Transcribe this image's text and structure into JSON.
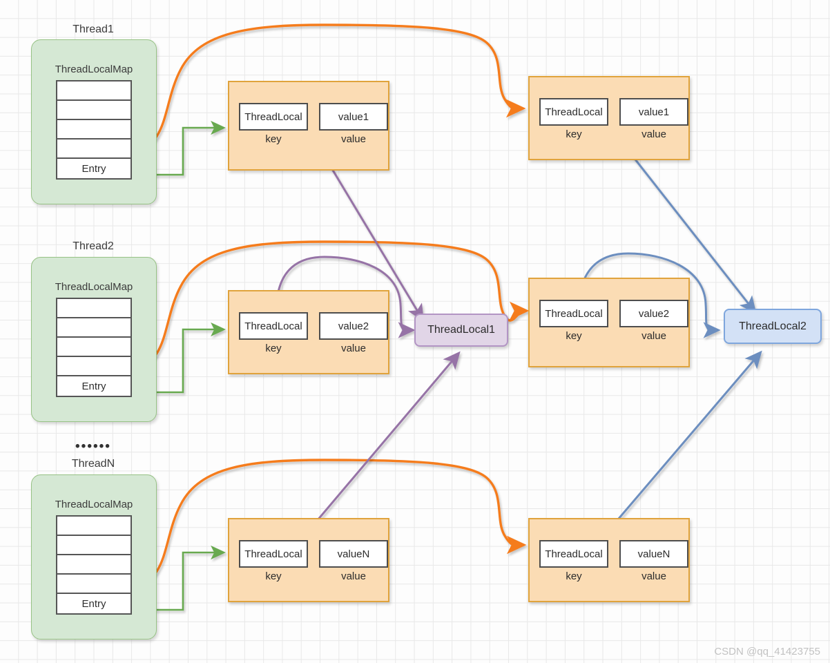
{
  "diagram": {
    "title": "ThreadLocal / ThreadLocalMap reference diagram",
    "watermark": "CSDN @qq_41423755",
    "colors": {
      "thread_fill": "#d5e8d4",
      "thread_stroke": "#82b366",
      "entry_fill": "#fbdcb4",
      "entry_stroke": "#e0a33c",
      "threadlocal1_fill": "#e1d5e7",
      "threadlocal1_stroke": "#b294c4",
      "threadlocal2_fill": "#d3e1f6",
      "threadlocal2_stroke": "#7ea6dd",
      "orange_edge": "#f57c1f",
      "green_edge": "#67a94f",
      "purple_edge": "#9673a6",
      "blue_edge": "#6c8ebf",
      "grid": "#e8e8e8"
    }
  },
  "threads": [
    {
      "name": "Thread1",
      "dots": "",
      "map_title": "ThreadLocalMap",
      "rows": [
        "",
        "",
        "",
        "",
        "Entry"
      ]
    },
    {
      "name": "Thread2",
      "dots": "",
      "map_title": "ThreadLocalMap",
      "rows": [
        "",
        "",
        "",
        "",
        "Entry"
      ]
    },
    {
      "name": "ThreadN",
      "dots": "••••••",
      "map_title": "ThreadLocalMap",
      "rows": [
        "",
        "",
        "",
        "",
        "Entry"
      ]
    }
  ],
  "entries": [
    {
      "id": "left-1",
      "key": "ThreadLocal",
      "value": "value1",
      "key_caption": "key",
      "value_caption": "value"
    },
    {
      "id": "right-1",
      "key": "ThreadLocal",
      "value": "value1",
      "key_caption": "key",
      "value_caption": "value"
    },
    {
      "id": "left-2",
      "key": "ThreadLocal",
      "value": "value2",
      "key_caption": "key",
      "value_caption": "value"
    },
    {
      "id": "right-2",
      "key": "ThreadLocal",
      "value": "value2",
      "key_caption": "key",
      "value_caption": "value"
    },
    {
      "id": "left-n",
      "key": "ThreadLocal",
      "value": "valueN",
      "key_caption": "key",
      "value_caption": "value"
    },
    {
      "id": "right-n",
      "key": "ThreadLocal",
      "value": "valueN",
      "key_caption": "key",
      "value_caption": "value"
    }
  ],
  "targets": [
    {
      "id": "threadlocal1",
      "label": "ThreadLocal1"
    },
    {
      "id": "threadlocal2",
      "label": "ThreadLocal2"
    }
  ],
  "edges": [
    {
      "from": "Thread1.map",
      "to": "right-1",
      "color": "orange"
    },
    {
      "from": "Thread2.map",
      "to": "right-2",
      "color": "orange"
    },
    {
      "from": "ThreadN.map",
      "to": "right-n",
      "color": "orange"
    },
    {
      "from": "Thread1.entry",
      "to": "left-1",
      "color": "green"
    },
    {
      "from": "Thread2.entry",
      "to": "left-2",
      "color": "green"
    },
    {
      "from": "ThreadN.entry",
      "to": "left-n",
      "color": "green"
    },
    {
      "from": "left-1.key",
      "to": "threadlocal1",
      "color": "purple"
    },
    {
      "from": "left-2.key",
      "to": "threadlocal1",
      "color": "purple"
    },
    {
      "from": "left-n.key",
      "to": "threadlocal1",
      "color": "purple"
    },
    {
      "from": "right-1.key",
      "to": "threadlocal2",
      "color": "blue"
    },
    {
      "from": "right-2.key",
      "to": "threadlocal2",
      "color": "blue"
    },
    {
      "from": "right-n.key",
      "to": "threadlocal2",
      "color": "blue"
    }
  ]
}
